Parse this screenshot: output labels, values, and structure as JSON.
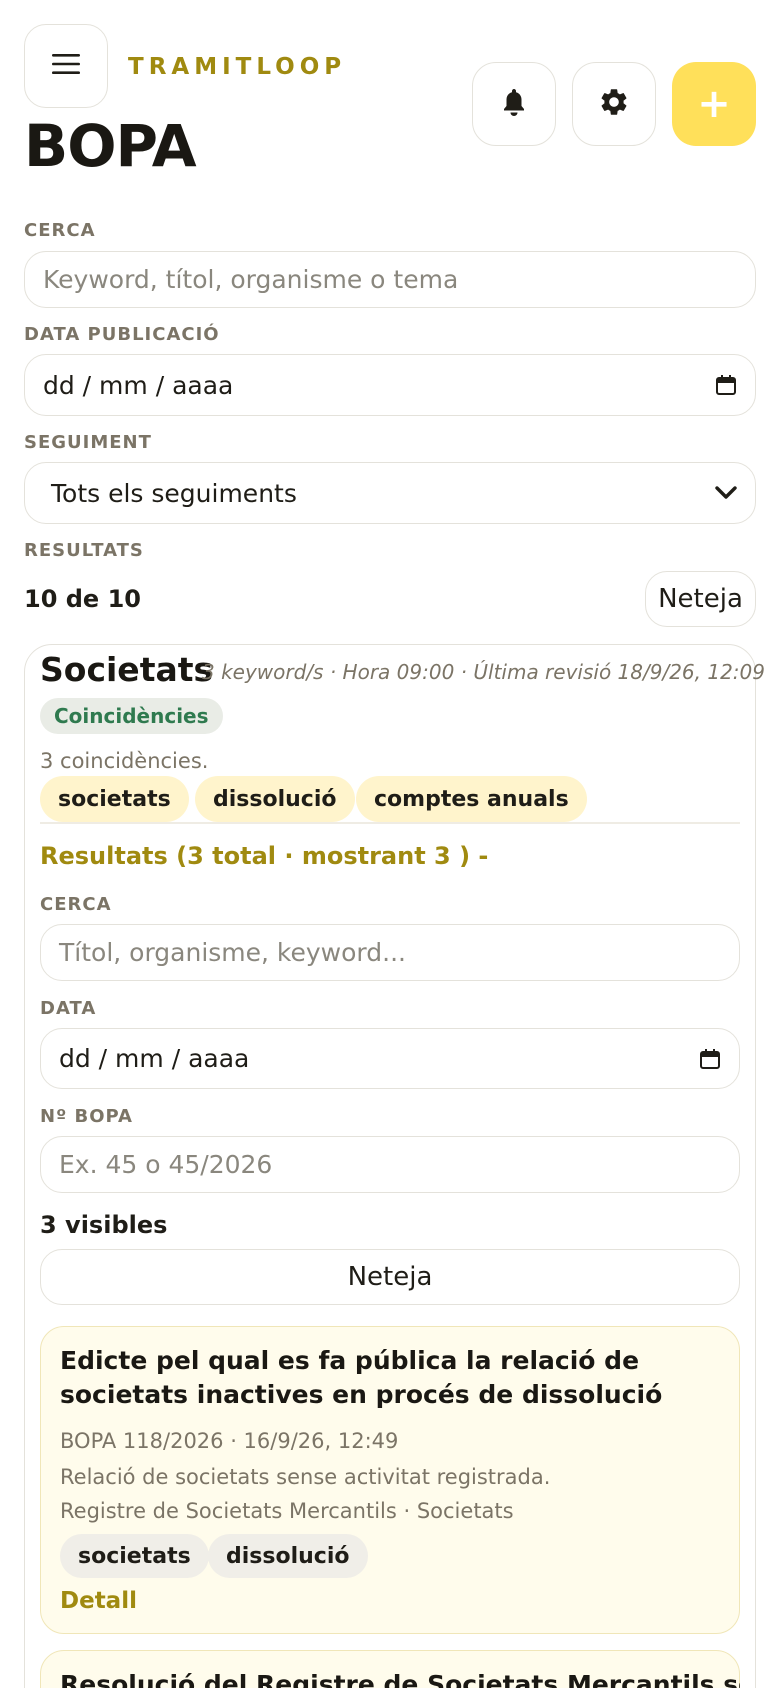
{
  "header": {
    "brand": "TRAMITLOOP",
    "title": "BOPA",
    "add_label": "+"
  },
  "filters": {
    "search_label": "CERCA",
    "search_placeholder": "Keyword, títol, organisme o tema",
    "date_label": "DATA PUBLICACIÓ",
    "date_value": "dd / mm / aaaa",
    "tracking_label": "SEGUIMENT",
    "tracking_value": "Tots els seguiments",
    "results_label": "RESULTATS",
    "results_count": "10 de 10",
    "clear_label": "Neteja"
  },
  "tracking_card": {
    "title": "Societats",
    "meta": "3 keyword/s · Hora 09:00 · Última revisió 18/9/26, 12:09",
    "status_badge": "Coincidències",
    "matches_text": "3 coincidències.",
    "keywords": [
      "societats",
      "dissolució",
      "comptes anuals"
    ],
    "results_toggle": "Resultats (3 total · mostrant 3 ) -",
    "inner_filters": {
      "search_label": "CERCA",
      "search_placeholder": "Títol, organisme, keyword...",
      "date_label": "DATA",
      "date_value": "dd / mm / aaaa",
      "bopa_label": "Nº BOPA",
      "bopa_placeholder": "Ex. 45 o 45/2026",
      "visible_count": "3 visibles",
      "clear_label": "Neteja"
    },
    "results": [
      {
        "title": "Edicte pel qual es fa pública la relació de societats inactives en procés de dissolució",
        "meta": "BOPA 118/2026 · 16/9/26, 12:49",
        "summary": "Relació de societats sense activitat registrada.",
        "source": "Registre de Societats Mercantils · Societats",
        "tags": [
          "societats",
          "dissolució"
        ],
        "detail_label": "Detall"
      },
      {
        "title": "Resolució del Registre de Societats Mercantils sobre la"
      }
    ]
  }
}
